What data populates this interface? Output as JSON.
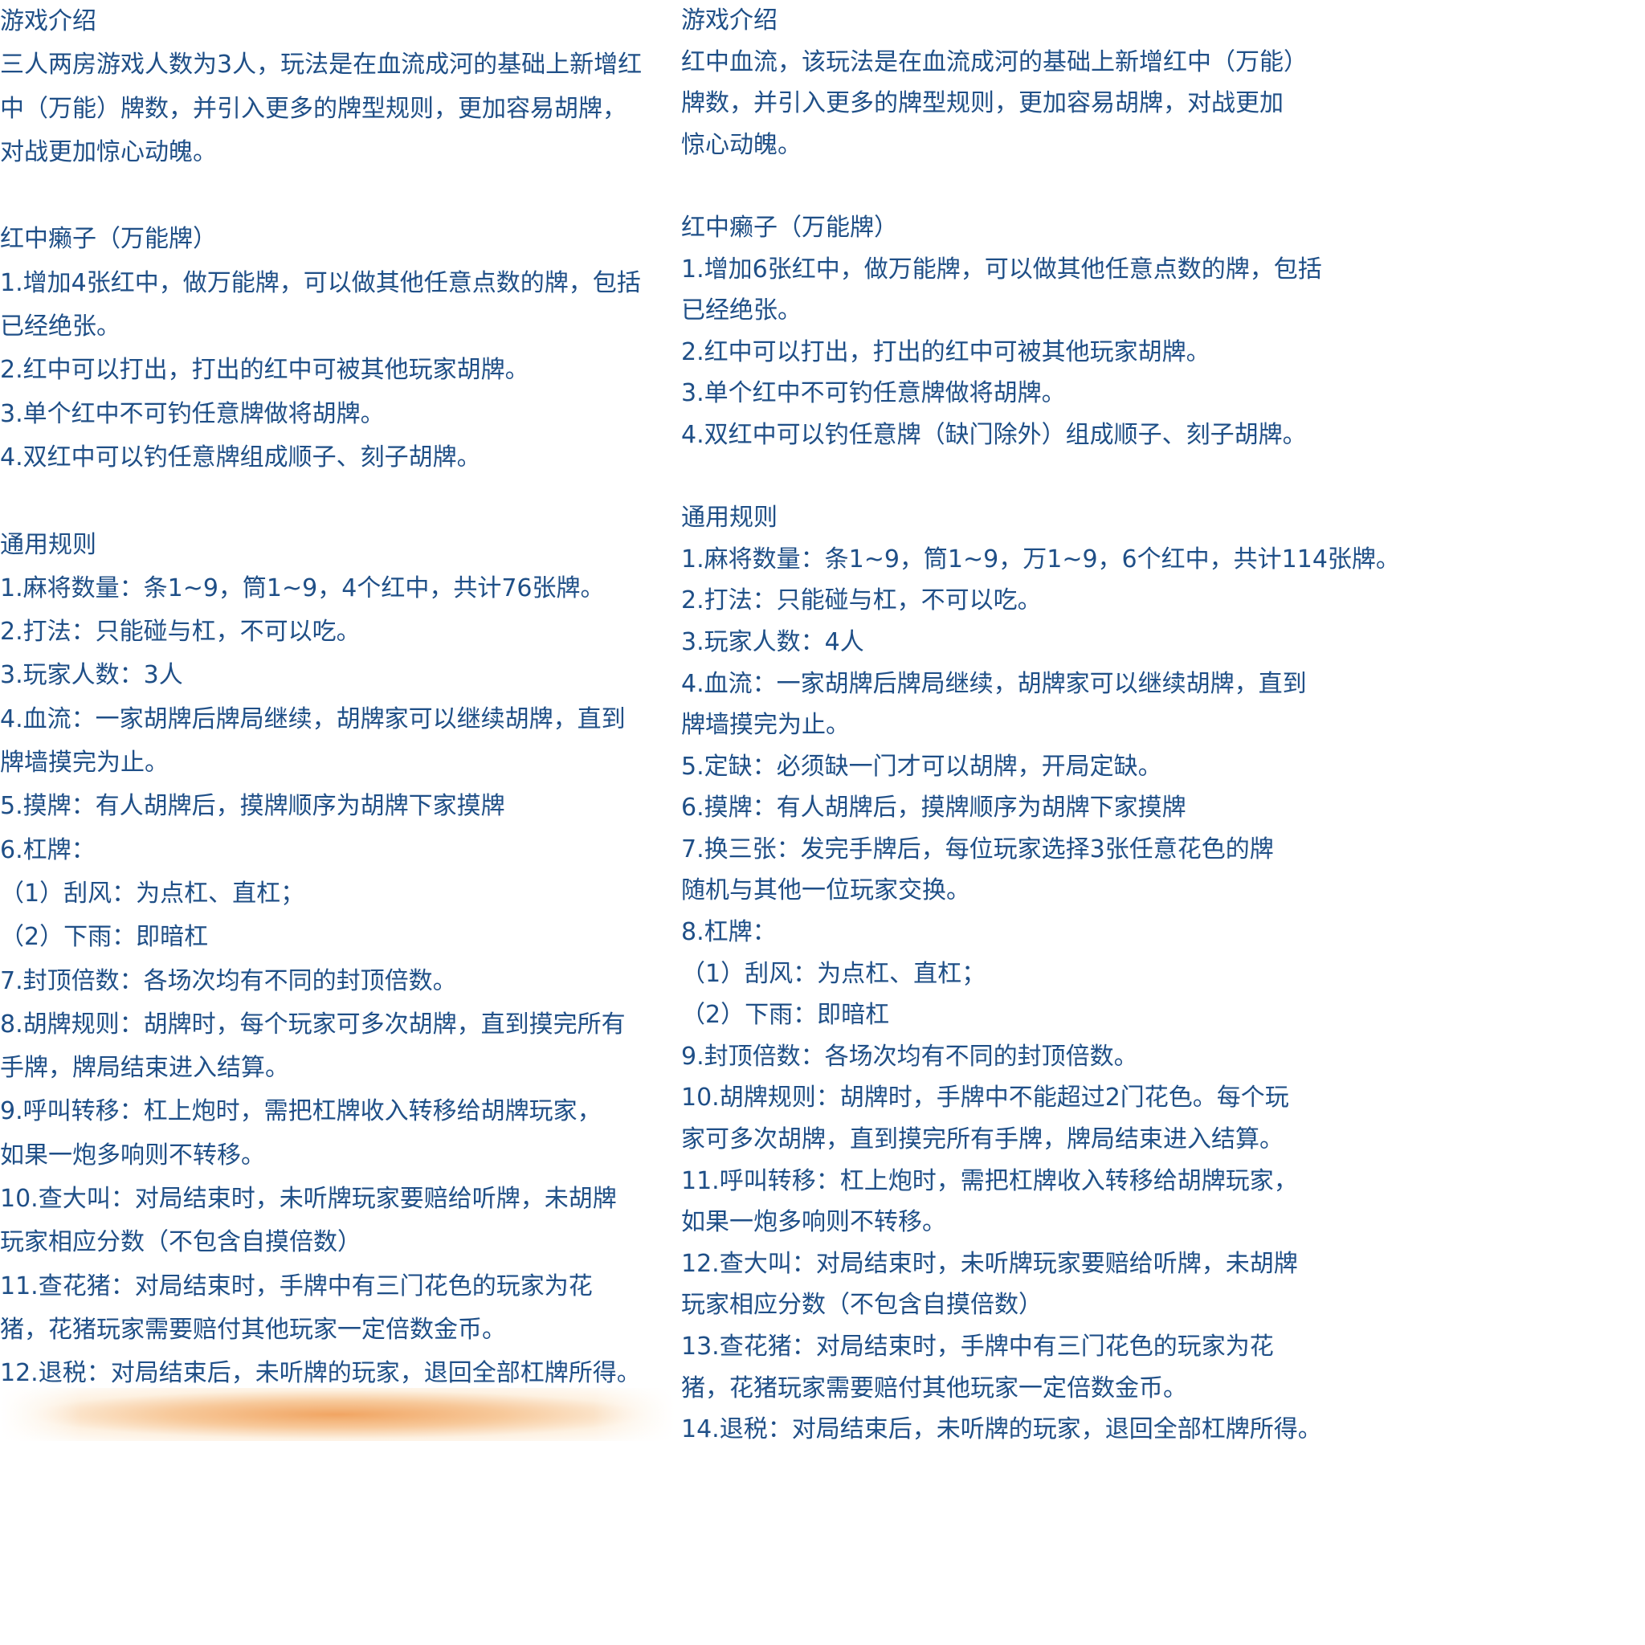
{
  "left": {
    "lines": [
      "游戏介绍",
      "三人两房游戏人数为3人，玩法是在血流成河的基础上新增红",
      "中（万能）牌数，并引入更多的牌型规则，更加容易胡牌，",
      "对战更加惊心动魄。",
      "",
      "红中癞子（万能牌）",
      "1.增加4张红中，做万能牌，可以做其他任意点数的牌，包括",
      "已经绝张。",
      "2.红中可以打出，打出的红中可被其他玩家胡牌。",
      "3.单个红中不可钓任意牌做将胡牌。",
      "4.双红中可以钓任意牌组成顺子、刻子胡牌。",
      "",
      "通用规则",
      "1.麻将数量：条1~9，筒1~9，4个红中，共计76张牌。",
      "2.打法：只能碰与杠，不可以吃。",
      "3.玩家人数：3人",
      "4.血流：一家胡牌后牌局继续，胡牌家可以继续胡牌，直到",
      "牌墙摸完为止。",
      "5.摸牌：有人胡牌后，摸牌顺序为胡牌下家摸牌",
      "6.杠牌：",
      "（1）刮风：为点杠、直杠；",
      "（2）下雨：即暗杠",
      "7.封顶倍数：各场次均有不同的封顶倍数。",
      "8.胡牌规则：胡牌时，每个玩家可多次胡牌，直到摸完所有",
      "手牌，牌局结束进入结算。",
      "9.呼叫转移：杠上炮时，需把杠牌收入转移给胡牌玩家，",
      "如果一炮多响则不转移。",
      "10.查大叫：对局结束时，未听牌玩家要赔给听牌，未胡牌",
      "玩家相应分数（不包含自摸倍数）",
      "11.查花猪：对局结束时，手牌中有三门花色的玩家为花",
      "猪，花猪玩家需要赔付其他玩家一定倍数金币。",
      "12.退税：对局结束后，未听牌的玩家，退回全部杠牌所得。"
    ]
  },
  "right": {
    "lines": [
      "游戏介绍",
      "红中血流，该玩法是在血流成河的基础上新增红中（万能）",
      "牌数，并引入更多的牌型规则，更加容易胡牌，对战更加",
      "惊心动魄。",
      "",
      "红中癞子（万能牌）",
      "1.增加6张红中，做万能牌，可以做其他任意点数的牌，包括",
      "已经绝张。",
      "2.红中可以打出，打出的红中可被其他玩家胡牌。",
      "3.单个红中不可钓任意牌做将胡牌。",
      "4.双红中可以钓任意牌（缺门除外）组成顺子、刻子胡牌。",
      "",
      "通用规则",
      "1.麻将数量：条1~9，筒1~9，万1~9，6个红中，共计114张牌。",
      "2.打法：只能碰与杠，不可以吃。",
      "3.玩家人数：4人",
      "4.血流：一家胡牌后牌局继续，胡牌家可以继续胡牌，直到",
      "牌墙摸完为止。",
      "5.定缺：必须缺一门才可以胡牌，开局定缺。",
      "6.摸牌：有人胡牌后，摸牌顺序为胡牌下家摸牌",
      "7.换三张：发完手牌后，每位玩家选择3张任意花色的牌",
      "随机与其他一位玩家交换。",
      "8.杠牌：",
      "（1）刮风：为点杠、直杠；",
      "（2）下雨：即暗杠",
      "9.封顶倍数：各场次均有不同的封顶倍数。",
      "10.胡牌规则：胡牌时，手牌中不能超过2门花色。每个玩",
      "家可多次胡牌，直到摸完所有手牌，牌局结束进入结算。",
      "11.呼叫转移：杠上炮时，需把杠牌收入转移给胡牌玩家，",
      "如果一炮多响则不转移。",
      "12.查大叫：对局结束时，未听牌玩家要赔给听牌，未胡牌",
      "玩家相应分数（不包含自摸倍数）",
      "13.查花猪：对局结束时，手牌中有三门花色的玩家为花",
      "猪，花猪玩家需要赔付其他玩家一定倍数金币。",
      "14.退税：对局结束后，未听牌的玩家，退回全部杠牌所得。"
    ]
  },
  "colors": {
    "text": "#1f4f87",
    "glow": "#f0a05a"
  }
}
